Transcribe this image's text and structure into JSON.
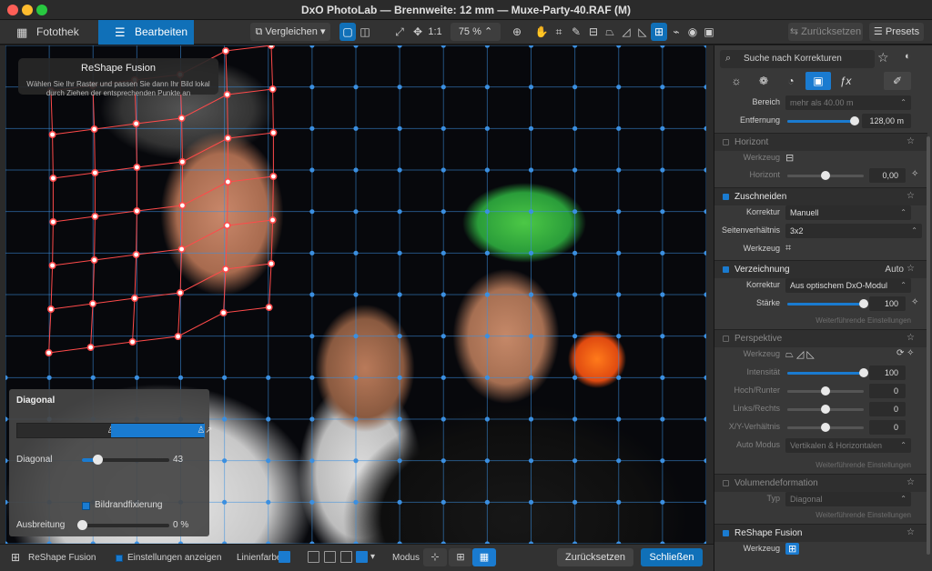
{
  "window": {
    "title": "DxO PhotoLab — Brennweite: 12 mm — Muxe-Party-40.RAF (M)"
  },
  "toolbar": {
    "tab_library": "Fotothek",
    "tab_edit": "Bearbeiten",
    "compare_label": "Vergleichen",
    "zoom_one_to_one": "1:1",
    "zoom_level": "75 %",
    "reset_label": "Zurücksetzen",
    "presets_label": "Presets"
  },
  "reshape_tooltip": {
    "title": "ReShape Fusion",
    "text": "Wählen Sie Ihr Raster und passen Sie dann Ihr Bild lokal durch Ziehen der entsprechenden Punkte an"
  },
  "diagonal_panel": {
    "title": "Diagonal",
    "diagonal_label": "Diagonal",
    "diagonal_value": "43",
    "diagonal_fraction": 0.18,
    "edge_fix_label": "Bildrandfixierung",
    "spread_label": "Ausbreitung",
    "spread_value": "0 %",
    "spread_fraction": 0.0
  },
  "bottom_bar": {
    "tool_name": "ReShape Fusion",
    "show_settings_label": "Einstellungen anzeigen",
    "line_color_label": "Linienfarbe",
    "line_color": "#1a7bd0",
    "mode_label": "Modus",
    "reset_button": "Zurücksetzen",
    "close_button": "Schließen"
  },
  "right_panel": {
    "search_placeholder": "Suche nach Korrekturen",
    "area_label": "Bereich",
    "area_value": "mehr als 40.00 m",
    "distance_label": "Entfernung",
    "distance_value": "128,00 m",
    "distance_fraction": 1.0,
    "horizon_title": "Horizont",
    "horizon_tool_label": "Werkzeug",
    "horizon_label": "Horizont",
    "horizon_value": "0,00",
    "horizon_fraction": 0.5,
    "crop_title": "Zuschneiden",
    "crop_correction_label": "Korrektur",
    "crop_correction_value": "Manuell",
    "aspect_label": "Seitenverhältnis",
    "aspect_value": "3x2",
    "crop_tool_label": "Werkzeug",
    "distortion_title": "Verzeichnung",
    "distortion_mode": "Auto",
    "distortion_correction_label": "Korrektur",
    "distortion_correction_value": "Aus optischem DxO-Modul",
    "strength_label": "Stärke",
    "strength_value": "100",
    "strength_fraction": 1.0,
    "more_settings": "Weiterführende Einstellungen",
    "perspective_title": "Perspektive",
    "perspective_tool_label": "Werkzeug",
    "intensity_label": "Intensität",
    "intensity_value": "100",
    "intensity_fraction": 1.0,
    "updown_label": "Hoch/Runter",
    "updown_value": "0",
    "updown_fraction": 0.5,
    "leftright_label": "Links/Rechts",
    "leftright_value": "0",
    "leftright_fraction": 0.5,
    "xy_label": "X/Y-Verhältnis",
    "xy_value": "0",
    "xy_fraction": 0.5,
    "auto_mode_label": "Auto Modus",
    "auto_mode_value": "Vertikalen & Horizontalen",
    "volume_title": "Volumendeformation",
    "volume_type_label": "Typ",
    "volume_type_value": "Diagonal",
    "reshape_title": "ReShape Fusion",
    "reshape_tool_label": "Werkzeug"
  }
}
